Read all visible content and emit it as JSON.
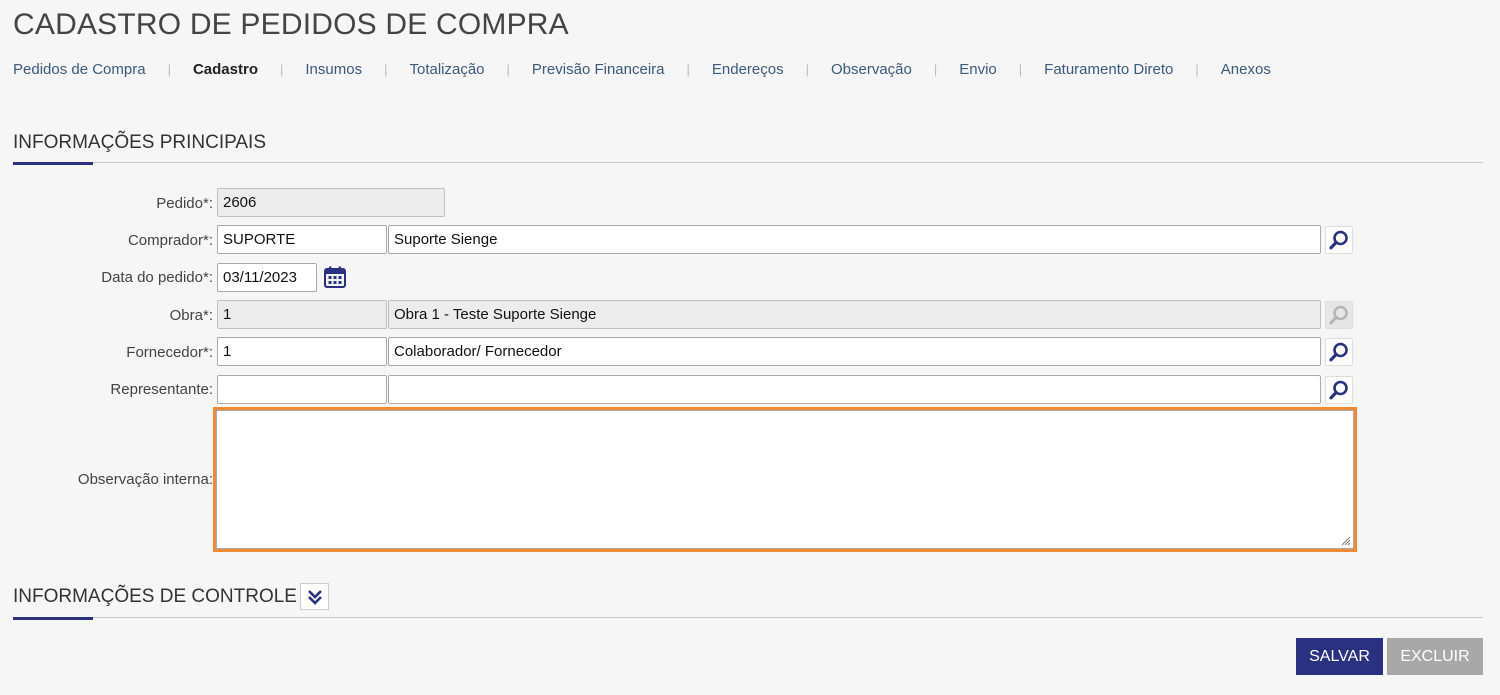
{
  "page_title": "CADASTRO DE PEDIDOS DE COMPRA",
  "tabs": [
    {
      "label": "Pedidos de Compra",
      "active": false
    },
    {
      "label": "Cadastro",
      "active": true
    },
    {
      "label": "Insumos",
      "active": false
    },
    {
      "label": "Totalização",
      "active": false
    },
    {
      "label": "Previsão Financeira",
      "active": false
    },
    {
      "label": "Endereços",
      "active": false
    },
    {
      "label": "Observação",
      "active": false
    },
    {
      "label": "Envio",
      "active": false
    },
    {
      "label": "Faturamento Direto",
      "active": false
    },
    {
      "label": "Anexos",
      "active": false
    }
  ],
  "main_section": {
    "title": "INFORMAÇÕES PRINCIPAIS",
    "pedido": {
      "label": "Pedido*:",
      "value": "2606"
    },
    "comprador": {
      "label": "Comprador*:",
      "code": "SUPORTE",
      "name": "Suporte Sienge"
    },
    "data_pedido": {
      "label": "Data do pedido*:",
      "value": "03/11/2023"
    },
    "obra": {
      "label": "Obra*:",
      "code": "1",
      "name": "Obra 1 - Teste Suporte Sienge"
    },
    "fornecedor": {
      "label": "Fornecedor*:",
      "code": "1",
      "name": "Colaborador/ Fornecedor"
    },
    "representante": {
      "label": "Representante:",
      "code": "",
      "name": ""
    },
    "observacao_interna": {
      "label": "Observação interna:",
      "value": ""
    }
  },
  "control_section": {
    "title": "INFORMAÇÕES DE CONTROLE"
  },
  "actions": {
    "save_label": "SALVAR",
    "delete_label": "EXCLUIR"
  },
  "colors": {
    "accent": "#2b3182",
    "focus_border": "#f08a35",
    "disabled_button": "#a8a8a8"
  },
  "icons": {
    "lookup": "magnifier-icon",
    "calendar": "calendar-icon",
    "expand": "double-chevron-down-icon"
  }
}
